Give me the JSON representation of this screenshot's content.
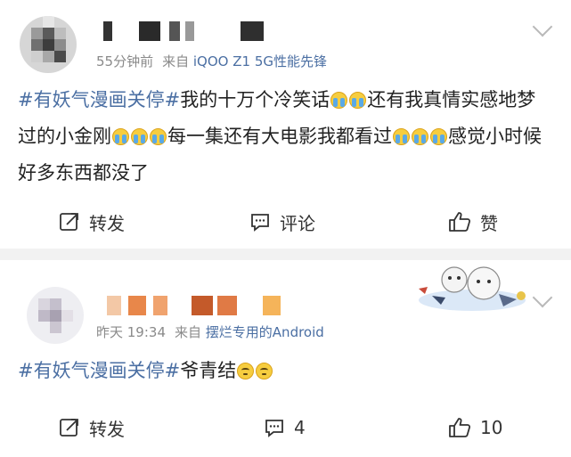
{
  "posts": [
    {
      "time": "55分钟前",
      "from_prefix": "来自",
      "source": "iQOO Z1 5G性能先锋",
      "hashtag": "#有妖气漫画关停#",
      "text1": "我的十万个冷笑话",
      "text2": "还有我真情实感地梦过的小金刚",
      "text3": "每一集还有大电影我都看过",
      "text4": "感觉小时候好多东西都没了",
      "actions": {
        "repost": "转发",
        "comment": "评论",
        "like": "赞"
      }
    },
    {
      "time": "昨天 19:34",
      "from_prefix": "来自",
      "source": "摆烂专用的Android",
      "hashtag": "#有妖气漫画关停#",
      "text1": "爷青结",
      "actions": {
        "repost": "转发",
        "comment": "4",
        "like": "10"
      }
    }
  ],
  "icons": {
    "repost": "repost-icon",
    "comment": "comment-icon",
    "like": "thumbs-up-icon",
    "more": "chevron-down-icon"
  },
  "colors": {
    "link": "#4b6fa3",
    "meta": "#8a8a8a",
    "separator": "#f2f2f2"
  }
}
